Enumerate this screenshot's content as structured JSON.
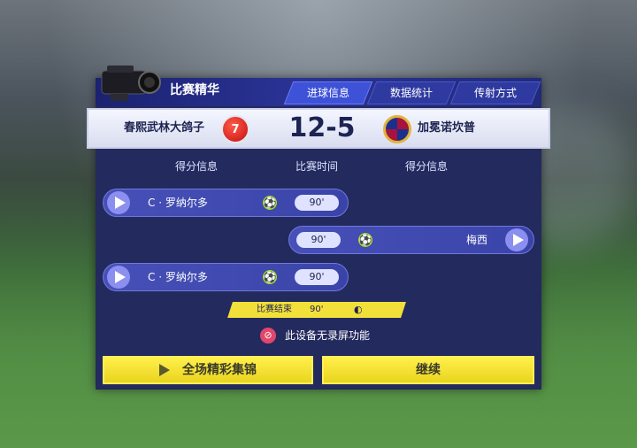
{
  "header": {
    "title": "比赛精华",
    "tabs": [
      {
        "label": "进球信息",
        "active": true
      },
      {
        "label": "数据统计",
        "active": false
      },
      {
        "label": "传射方式",
        "active": false
      }
    ]
  },
  "scoreboard": {
    "home_team": "春熙武林大鸽子",
    "home_badge_number": "7",
    "score": "12-5",
    "away_team": "加冕诺坎普"
  },
  "columns": {
    "left": "得分信息",
    "middle": "比赛时间",
    "right": "得分信息"
  },
  "events": [
    {
      "side": "home",
      "player": "C · 罗纳尔多",
      "time": "90'",
      "icon": "soccer-ball-icon"
    },
    {
      "side": "away",
      "player": "梅西",
      "time": "90'",
      "icon": "soccer-ball-icon"
    },
    {
      "side": "home",
      "player": "C · 罗纳尔多",
      "time": "90'",
      "icon": "soccer-ball-icon"
    }
  ],
  "match_end": {
    "label": "比赛结束",
    "time": "90'",
    "icon": "whistle-icon"
  },
  "no_record": {
    "text": "此设备无录屏功能",
    "icon": "no-record-icon"
  },
  "buttons": {
    "highlights": "全场精彩集锦",
    "continue": "继续"
  },
  "colors": {
    "panel": "#232a5e",
    "accent_yellow": "#f2e03a",
    "home_badge": "#d31e1e",
    "score_text": "#1e2452"
  }
}
